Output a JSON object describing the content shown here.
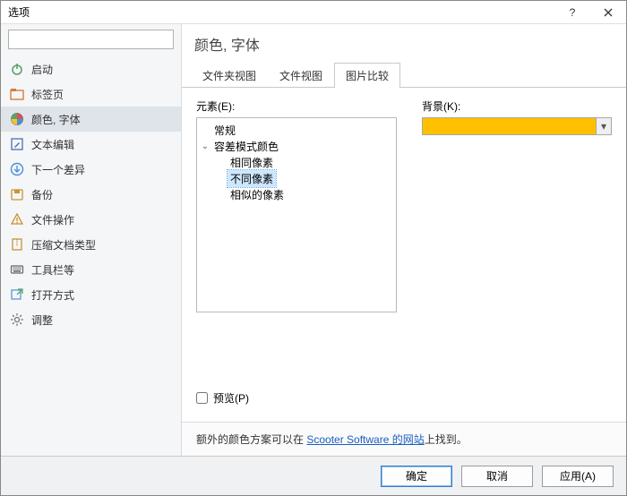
{
  "window": {
    "title": "选项"
  },
  "search": {
    "placeholder": ""
  },
  "sidebar": {
    "items": [
      {
        "label": "启动"
      },
      {
        "label": "标签页"
      },
      {
        "label": "颜色, 字体"
      },
      {
        "label": "文本编辑"
      },
      {
        "label": "下一个差异"
      },
      {
        "label": "备份"
      },
      {
        "label": "文件操作"
      },
      {
        "label": "压缩文档类型"
      },
      {
        "label": "工具栏等"
      },
      {
        "label": "打开方式"
      },
      {
        "label": "调整"
      }
    ]
  },
  "heading": "颜色, 字体",
  "tabs": [
    {
      "label": "文件夹视图"
    },
    {
      "label": "文件视图"
    },
    {
      "label": "图片比较"
    }
  ],
  "treeLabel": "元素(E):",
  "tree": {
    "n0": "常规",
    "n1": "容差模式颜色",
    "n2": "相同像素",
    "n3": "不同像素",
    "n4": "相似的像素"
  },
  "bg": {
    "label": "背景(K):",
    "color": "#ffc000"
  },
  "preview": {
    "label": "预览(P)"
  },
  "footnote": {
    "pre": "额外的颜色方案可以在 ",
    "link": "Scooter Software 的网站",
    "post": "上找到。"
  },
  "buttons": {
    "ok": "确定",
    "cancel": "取消",
    "apply": "应用(A)"
  }
}
